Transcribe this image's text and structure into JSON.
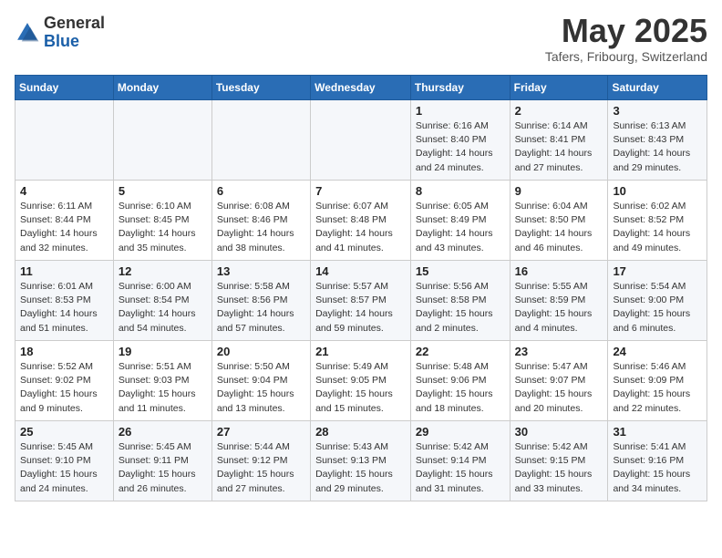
{
  "header": {
    "logo_line1": "General",
    "logo_line2": "Blue",
    "month": "May 2025",
    "location": "Tafers, Fribourg, Switzerland"
  },
  "days_of_week": [
    "Sunday",
    "Monday",
    "Tuesday",
    "Wednesday",
    "Thursday",
    "Friday",
    "Saturday"
  ],
  "weeks": [
    [
      {
        "day": "",
        "info": ""
      },
      {
        "day": "",
        "info": ""
      },
      {
        "day": "",
        "info": ""
      },
      {
        "day": "",
        "info": ""
      },
      {
        "day": "1",
        "info": "Sunrise: 6:16 AM\nSunset: 8:40 PM\nDaylight: 14 hours\nand 24 minutes."
      },
      {
        "day": "2",
        "info": "Sunrise: 6:14 AM\nSunset: 8:41 PM\nDaylight: 14 hours\nand 27 minutes."
      },
      {
        "day": "3",
        "info": "Sunrise: 6:13 AM\nSunset: 8:43 PM\nDaylight: 14 hours\nand 29 minutes."
      }
    ],
    [
      {
        "day": "4",
        "info": "Sunrise: 6:11 AM\nSunset: 8:44 PM\nDaylight: 14 hours\nand 32 minutes."
      },
      {
        "day": "5",
        "info": "Sunrise: 6:10 AM\nSunset: 8:45 PM\nDaylight: 14 hours\nand 35 minutes."
      },
      {
        "day": "6",
        "info": "Sunrise: 6:08 AM\nSunset: 8:46 PM\nDaylight: 14 hours\nand 38 minutes."
      },
      {
        "day": "7",
        "info": "Sunrise: 6:07 AM\nSunset: 8:48 PM\nDaylight: 14 hours\nand 41 minutes."
      },
      {
        "day": "8",
        "info": "Sunrise: 6:05 AM\nSunset: 8:49 PM\nDaylight: 14 hours\nand 43 minutes."
      },
      {
        "day": "9",
        "info": "Sunrise: 6:04 AM\nSunset: 8:50 PM\nDaylight: 14 hours\nand 46 minutes."
      },
      {
        "day": "10",
        "info": "Sunrise: 6:02 AM\nSunset: 8:52 PM\nDaylight: 14 hours\nand 49 minutes."
      }
    ],
    [
      {
        "day": "11",
        "info": "Sunrise: 6:01 AM\nSunset: 8:53 PM\nDaylight: 14 hours\nand 51 minutes."
      },
      {
        "day": "12",
        "info": "Sunrise: 6:00 AM\nSunset: 8:54 PM\nDaylight: 14 hours\nand 54 minutes."
      },
      {
        "day": "13",
        "info": "Sunrise: 5:58 AM\nSunset: 8:56 PM\nDaylight: 14 hours\nand 57 minutes."
      },
      {
        "day": "14",
        "info": "Sunrise: 5:57 AM\nSunset: 8:57 PM\nDaylight: 14 hours\nand 59 minutes."
      },
      {
        "day": "15",
        "info": "Sunrise: 5:56 AM\nSunset: 8:58 PM\nDaylight: 15 hours\nand 2 minutes."
      },
      {
        "day": "16",
        "info": "Sunrise: 5:55 AM\nSunset: 8:59 PM\nDaylight: 15 hours\nand 4 minutes."
      },
      {
        "day": "17",
        "info": "Sunrise: 5:54 AM\nSunset: 9:00 PM\nDaylight: 15 hours\nand 6 minutes."
      }
    ],
    [
      {
        "day": "18",
        "info": "Sunrise: 5:52 AM\nSunset: 9:02 PM\nDaylight: 15 hours\nand 9 minutes."
      },
      {
        "day": "19",
        "info": "Sunrise: 5:51 AM\nSunset: 9:03 PM\nDaylight: 15 hours\nand 11 minutes."
      },
      {
        "day": "20",
        "info": "Sunrise: 5:50 AM\nSunset: 9:04 PM\nDaylight: 15 hours\nand 13 minutes."
      },
      {
        "day": "21",
        "info": "Sunrise: 5:49 AM\nSunset: 9:05 PM\nDaylight: 15 hours\nand 15 minutes."
      },
      {
        "day": "22",
        "info": "Sunrise: 5:48 AM\nSunset: 9:06 PM\nDaylight: 15 hours\nand 18 minutes."
      },
      {
        "day": "23",
        "info": "Sunrise: 5:47 AM\nSunset: 9:07 PM\nDaylight: 15 hours\nand 20 minutes."
      },
      {
        "day": "24",
        "info": "Sunrise: 5:46 AM\nSunset: 9:09 PM\nDaylight: 15 hours\nand 22 minutes."
      }
    ],
    [
      {
        "day": "25",
        "info": "Sunrise: 5:45 AM\nSunset: 9:10 PM\nDaylight: 15 hours\nand 24 minutes."
      },
      {
        "day": "26",
        "info": "Sunrise: 5:45 AM\nSunset: 9:11 PM\nDaylight: 15 hours\nand 26 minutes."
      },
      {
        "day": "27",
        "info": "Sunrise: 5:44 AM\nSunset: 9:12 PM\nDaylight: 15 hours\nand 27 minutes."
      },
      {
        "day": "28",
        "info": "Sunrise: 5:43 AM\nSunset: 9:13 PM\nDaylight: 15 hours\nand 29 minutes."
      },
      {
        "day": "29",
        "info": "Sunrise: 5:42 AM\nSunset: 9:14 PM\nDaylight: 15 hours\nand 31 minutes."
      },
      {
        "day": "30",
        "info": "Sunrise: 5:42 AM\nSunset: 9:15 PM\nDaylight: 15 hours\nand 33 minutes."
      },
      {
        "day": "31",
        "info": "Sunrise: 5:41 AM\nSunset: 9:16 PM\nDaylight: 15 hours\nand 34 minutes."
      }
    ]
  ]
}
